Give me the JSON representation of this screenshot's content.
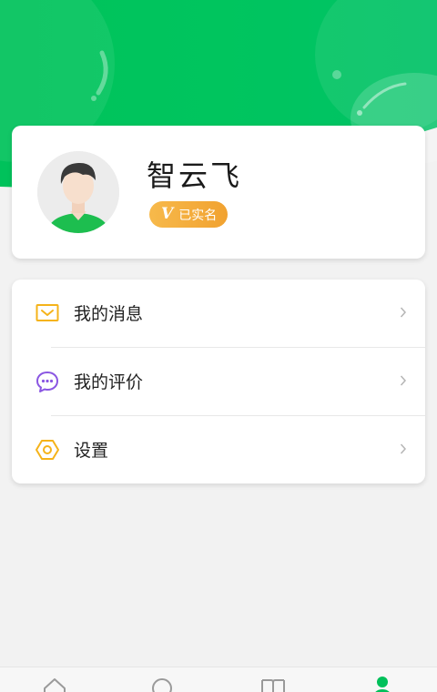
{
  "user": {
    "name": "智云飞",
    "verify_badge": {
      "v_glyph": "V",
      "label": "已实名"
    }
  },
  "menu": [
    {
      "label": "我的消息",
      "icon": "envelope-icon",
      "icon_color": "#f5b31a"
    },
    {
      "label": "我的评价",
      "icon": "comment-icon",
      "icon_color": "#8a56e2"
    },
    {
      "label": "设置",
      "icon": "settings-hexagon-icon",
      "icon_color": "#f5b31a"
    }
  ],
  "tabs": [
    {
      "icon": "home-icon",
      "active": false
    },
    {
      "icon": "search-icon",
      "active": false
    },
    {
      "icon": "book-icon",
      "active": false
    },
    {
      "icon": "profile-icon",
      "active": true
    }
  ],
  "colors": {
    "brand_green": "#00c05a",
    "badge_orange": "#f3a936",
    "page_background": "#f2f2f2",
    "inactive_tab": "#9a9a9a"
  }
}
